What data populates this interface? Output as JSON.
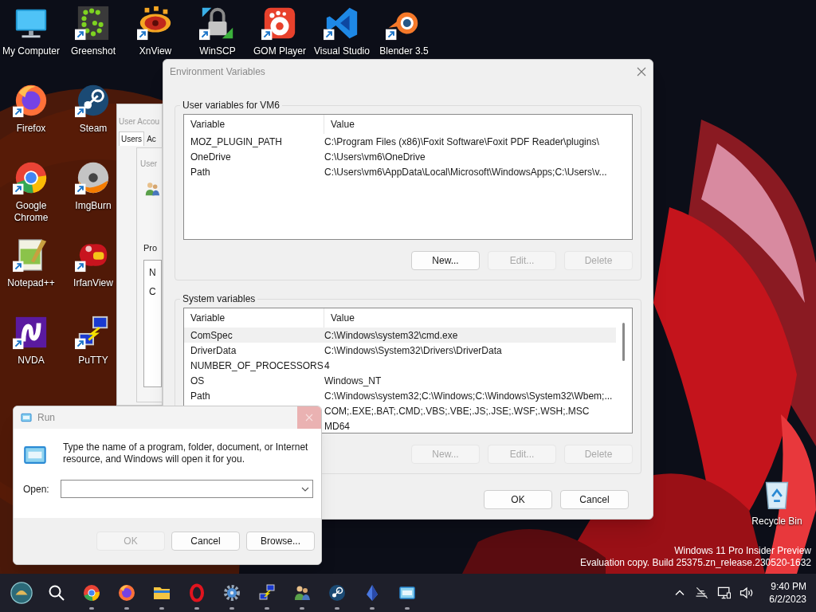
{
  "desktop_columns": [
    [
      {
        "kind": "computer",
        "label": "My Computer",
        "shortcut": false
      },
      {
        "kind": "firefox",
        "label": "Firefox",
        "shortcut": true
      },
      {
        "kind": "chrome",
        "label": "Google Chrome",
        "shortcut": true
      },
      {
        "kind": "notepad",
        "label": "Notepad++",
        "shortcut": true
      },
      {
        "kind": "nvda",
        "label": "NVDA",
        "shortcut": true
      }
    ],
    [
      {
        "kind": "greenshot",
        "label": "Greenshot",
        "shortcut": true
      },
      {
        "kind": "steam",
        "label": "Steam",
        "shortcut": true
      },
      {
        "kind": "imgburn",
        "label": "ImgBurn",
        "shortcut": true
      },
      {
        "kind": "irfanview",
        "label": "IrfanView",
        "shortcut": true
      },
      {
        "kind": "putty",
        "label": "PuTTY",
        "shortcut": true
      }
    ],
    [
      {
        "kind": "xnview",
        "label": "XnView",
        "shortcut": true
      }
    ],
    [
      {
        "kind": "winscp",
        "label": "WinSCP",
        "shortcut": true
      }
    ],
    [
      {
        "kind": "gom",
        "label": "GOM Player",
        "shortcut": true
      }
    ],
    [
      {
        "kind": "vscode",
        "label": "Visual Studio",
        "shortcut": true
      }
    ],
    [
      {
        "kind": "blender",
        "label": "Blender 3.5",
        "shortcut": true
      }
    ]
  ],
  "recycle_bin": {
    "label": "Recycle Bin"
  },
  "user_accounts_window": {
    "title": "User Accou",
    "tabs": [
      {
        "label": "Users",
        "selected": true
      },
      {
        "label": "Ac",
        "selected": false
      }
    ],
    "inner_window": {
      "title": "User",
      "section": "Pro",
      "list_items": [
        "N",
        "C"
      ]
    }
  },
  "environment_variables": {
    "title": "Environment Variables",
    "groups": [
      {
        "legend": "User variables for VM6",
        "columns": [
          "Variable",
          "Value"
        ],
        "rows": [
          {
            "variable": "MOZ_PLUGIN_PATH",
            "value": "C:\\Program Files (x86)\\Foxit Software\\Foxit PDF Reader\\plugins\\",
            "selected": false
          },
          {
            "variable": "OneDrive",
            "value": "C:\\Users\\vm6\\OneDrive",
            "selected": false
          },
          {
            "variable": "Path",
            "value": "C:\\Users\\vm6\\AppData\\Local\\Microsoft\\WindowsApps;C:\\Users\\v...",
            "selected": false
          }
        ],
        "buttons": [
          {
            "label": "New...",
            "disabled": false
          },
          {
            "label": "Edit...",
            "disabled": true
          },
          {
            "label": "Delete",
            "disabled": true
          }
        ]
      },
      {
        "legend": "System variables",
        "columns": [
          "Variable",
          "Value"
        ],
        "rows": [
          {
            "variable": "ComSpec",
            "value": "C:\\Windows\\system32\\cmd.exe",
            "selected": true
          },
          {
            "variable": "DriverData",
            "value": "C:\\Windows\\System32\\Drivers\\DriverData",
            "selected": false
          },
          {
            "variable": "NUMBER_OF_PROCESSORS",
            "value": "4",
            "selected": false
          },
          {
            "variable": "OS",
            "value": "Windows_NT",
            "selected": false
          },
          {
            "variable": "Path",
            "value": "C:\\Windows\\system32;C:\\Windows;C:\\Windows\\System32\\Wbem;...",
            "selected": false
          },
          {
            "value": "COM;.EXE;.BAT;.CMD;.VBS;.VBE;.JS;.JSE;.WSF;.WSH;.MSC",
            "selected": false
          },
          {
            "value": "MD64",
            "selected": false
          }
        ],
        "buttons": [
          {
            "label": "New...",
            "disabled": true
          },
          {
            "label": "Edit...",
            "disabled": true
          },
          {
            "label": "Delete",
            "disabled": true
          }
        ]
      }
    ],
    "buttons": [
      {
        "label": "OK",
        "disabled": false
      },
      {
        "label": "Cancel",
        "disabled": false
      }
    ]
  },
  "run_dialog": {
    "title": "Run",
    "message": "Type the name of a program, folder, document, or Internet resource, and Windows will open it for you.",
    "open_label": "Open:",
    "buttons": [
      {
        "label": "OK",
        "disabled": true
      },
      {
        "label": "Cancel",
        "disabled": false
      },
      {
        "label": "Browse...",
        "disabled": false
      }
    ]
  },
  "watermark": [
    "Windows 11 Pro Insider Preview",
    "Evaluation copy. Build 25375.zn_release.230520-1632"
  ],
  "taskbar": {
    "items": [
      {
        "kind": "start",
        "running": false
      },
      {
        "kind": "search",
        "running": false
      },
      {
        "kind": "chrome",
        "running": true
      },
      {
        "kind": "firefox",
        "running": true
      },
      {
        "kind": "folder",
        "running": true
      },
      {
        "kind": "opera",
        "running": true
      },
      {
        "kind": "gear",
        "running": true
      },
      {
        "kind": "putty",
        "running": true
      },
      {
        "kind": "people",
        "running": true
      },
      {
        "kind": "steam",
        "running": true
      },
      {
        "kind": "crystal",
        "running": true
      },
      {
        "kind": "runwin",
        "running": true
      }
    ],
    "tray": [
      {
        "kind": "chevron"
      },
      {
        "kind": "netoff"
      },
      {
        "kind": "display"
      },
      {
        "kind": "speaker"
      }
    ],
    "time": "9:40 PM",
    "date": "6/2/2023"
  }
}
